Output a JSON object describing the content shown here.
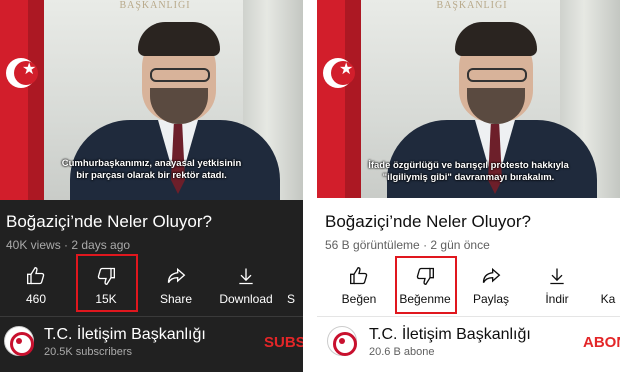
{
  "left": {
    "video": {
      "subtitle_line1": "Cumhurbaşkanımız, anayasal yetkisinin",
      "subtitle_line2": "bir parçası olarak bir rektör atadı.",
      "crest_text": "BAŞKANLIĞI"
    },
    "title": "Boğaziçi’nde Neler Oluyor?",
    "meta": "40K views · 2 days ago",
    "actions": [
      {
        "label": "460",
        "icon": "thumbs-up-icon"
      },
      {
        "label": "15K",
        "icon": "thumbs-down-icon",
        "highlighted": true
      },
      {
        "label": "Share",
        "icon": "share-icon"
      },
      {
        "label": "Download",
        "icon": "download-icon"
      },
      {
        "label": "S",
        "icon": "save-icon"
      }
    ],
    "channel": {
      "name": "T.C. İletişim Başkanlığı",
      "subscribers": "20.5K subscribers",
      "subscribe_label": "SUBS"
    }
  },
  "right": {
    "video": {
      "subtitle_line1": "İfade özgürlüğü ve barışçıl protesto hakkıyla",
      "subtitle_line2": "\"ilgiliymiş gibi\" davranmayı bırakalım.",
      "crest_text": "BAŞKANLIĞI"
    },
    "title": "Boğaziçi’nde Neler Oluyor?",
    "meta": "56 B görüntüleme · 2 gün önce",
    "actions": [
      {
        "label": "Beğen",
        "icon": "thumbs-up-icon"
      },
      {
        "label": "Beğenme",
        "icon": "thumbs-down-icon",
        "highlighted": true
      },
      {
        "label": "Paylaş",
        "icon": "share-icon"
      },
      {
        "label": "İndir",
        "icon": "download-icon"
      },
      {
        "label": "Ka",
        "icon": "save-icon"
      }
    ],
    "channel": {
      "name": "T.C. İletişim Başkanlığı",
      "subscribers": "20.6 B abone",
      "subscribe_label": "ABON"
    }
  },
  "colors": {
    "highlight": "#e0171e",
    "subscribe": "#e32628",
    "dark_bg": "#212121",
    "light_bg": "#ffffff"
  }
}
